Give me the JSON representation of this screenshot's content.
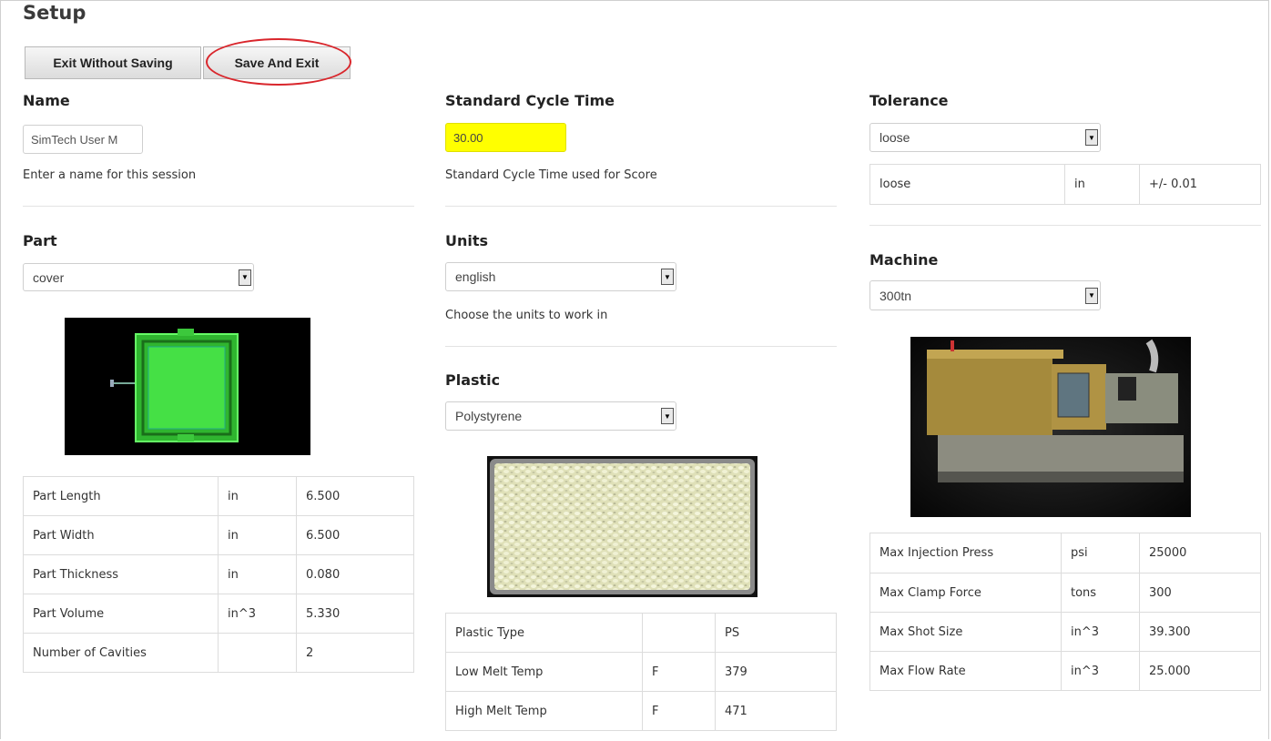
{
  "page": {
    "title": "Setup"
  },
  "toolbar": {
    "exit_label": "Exit Without Saving",
    "save_label": "Save And Exit"
  },
  "name": {
    "label": "Name",
    "value": "SimTech User M",
    "help": "Enter a name for this session"
  },
  "cycle": {
    "label": "Standard Cycle Time",
    "value": "30.00",
    "help": "Standard Cycle Time used for Score"
  },
  "tolerance": {
    "label": "Tolerance",
    "selected": "loose",
    "row": [
      "loose",
      "in",
      "+/- 0.01"
    ]
  },
  "part": {
    "label": "Part",
    "selected": "cover",
    "rows": [
      [
        "Part Length",
        "in",
        "6.500"
      ],
      [
        "Part Width",
        "in",
        "6.500"
      ],
      [
        "Part Thickness",
        "in",
        "0.080"
      ],
      [
        "Part Volume",
        "in^3",
        "5.330"
      ],
      [
        "Number of Cavities",
        "",
        "2"
      ]
    ]
  },
  "units": {
    "label": "Units",
    "selected": "english",
    "help": "Choose the units to work in"
  },
  "plastic": {
    "label": "Plastic",
    "selected": "Polystyrene",
    "rows": [
      [
        "Plastic Type",
        "",
        "PS"
      ],
      [
        "Low Melt Temp",
        "F",
        "379"
      ],
      [
        "High Melt Temp",
        "F",
        "471"
      ]
    ]
  },
  "machine": {
    "label": "Machine",
    "selected": "300tn",
    "rows": [
      [
        "Max Injection Press",
        "psi",
        "25000"
      ],
      [
        "Max Clamp Force",
        "tons",
        "300"
      ],
      [
        "Max Shot Size",
        "in^3",
        "39.300"
      ],
      [
        "Max Flow Rate",
        "in^3",
        "25.000"
      ]
    ]
  },
  "colors": {
    "highlight": "#ffff00",
    "annotation": "#d9262c",
    "part_green": "#3cd23c"
  }
}
